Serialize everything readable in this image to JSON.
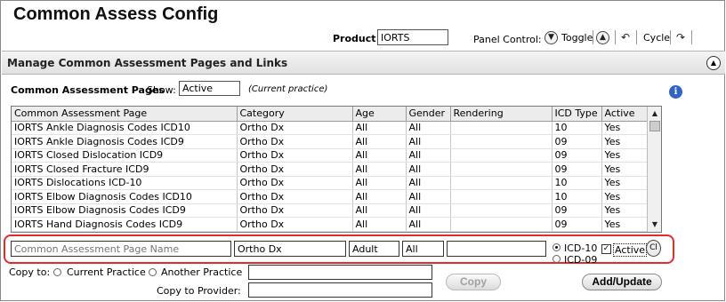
{
  "app": {
    "title": "Common Assess Config"
  },
  "header": {
    "product_label": "Product",
    "product_value": "IORTS",
    "panel_control_label": "Panel Control:",
    "toggle_label": "Toggle",
    "cycle_label": "Cycle"
  },
  "section": {
    "title": "Manage Common Assessment Pages and Links"
  },
  "filter": {
    "label": "Common Assessment Pages",
    "show_label": "Show:",
    "show_value": "Active",
    "note": "(Current practice)"
  },
  "table": {
    "columns": [
      "Common Assessment Page",
      "Category",
      "Age",
      "Gender",
      "Rendering",
      "ICD Type",
      "Active"
    ],
    "rows": [
      [
        "IORTS Ankle Diagnosis Codes ICD10",
        "Ortho Dx",
        "All",
        "All",
        "",
        "10",
        "Yes"
      ],
      [
        "IORTS Ankle Diagnosis Codes ICD9",
        "Ortho Dx",
        "All",
        "All",
        "",
        "09",
        "Yes"
      ],
      [
        "IORTS Closed Dislocation ICD9",
        "Ortho Dx",
        "All",
        "All",
        "",
        "09",
        "Yes"
      ],
      [
        "IORTS Closed Fracture ICD9",
        "Ortho Dx",
        "All",
        "All",
        "",
        "09",
        "Yes"
      ],
      [
        "IORTS Dislocations ICD-10",
        "Ortho Dx",
        "All",
        "All",
        "",
        "10",
        "Yes"
      ],
      [
        "IORTS Elbow Diagnosis Codes ICD10",
        "Ortho Dx",
        "All",
        "All",
        "",
        "10",
        "Yes"
      ],
      [
        "IORTS Elbow Diagnosis Codes ICD9",
        "Ortho Dx",
        "All",
        "All",
        "",
        "09",
        "Yes"
      ],
      [
        "IORTS Hand Diagnosis Codes ICD9",
        "Ortho Dx",
        "All",
        "All",
        "",
        "09",
        "Yes"
      ]
    ]
  },
  "edit": {
    "name_placeholder": "Common Assessment Page Name",
    "category": "Ortho Dx",
    "age": "Adult",
    "gender": "All",
    "rendering": "",
    "icd10_label": "ICD-10",
    "icd9_label": "ICD-09",
    "active_label": "Active",
    "clear_label": "Cl"
  },
  "copy": {
    "copy_to_label": "Copy to:",
    "current_practice_label": "Current Practice",
    "another_practice_label": "Another Practice",
    "copy_to_provider_label": "Copy to Provider:",
    "copy_button": "Copy",
    "add_update_button": "Add/Update"
  }
}
